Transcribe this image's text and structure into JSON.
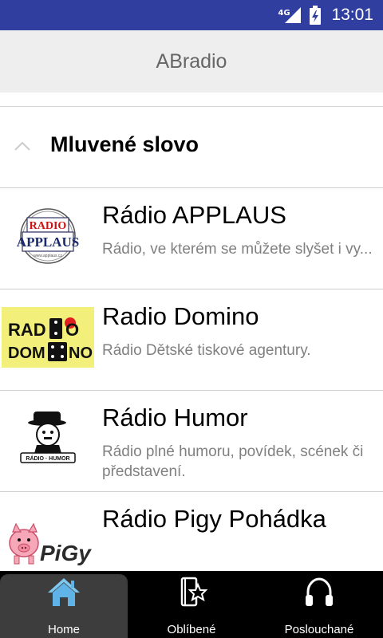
{
  "status_bar": {
    "network_type": "4G",
    "time": "13:01",
    "background_color": "#303f9f",
    "icons": [
      "signal-icon",
      "battery-charging-icon"
    ]
  },
  "app_bar": {
    "title": "ABradio",
    "background_color": "#eeeeee"
  },
  "section": {
    "title": "Mluvené slovo",
    "icon": "chevron-up-icon"
  },
  "stations": [
    {
      "name": "Rádio APPLAUS",
      "description": "Rádio, ve kterém se můžete slyšet i vy...",
      "logo_text": "RADIO APPLAUS"
    },
    {
      "name": "Radio Domino",
      "description": "Rádio Dětské tiskové agentury.",
      "logo_text": "RADIO DOMINO"
    },
    {
      "name": "Rádio Humor",
      "description": "Rádio plné humoru, povídek, scének či představení.",
      "logo_text": "RÁDIO HUMOR"
    },
    {
      "name": "Rádio Pigy Pohádka",
      "description": "",
      "logo_text": "PiGy"
    }
  ],
  "bottom_nav": {
    "background_color": "#000000",
    "active_color": "#3d3d3d",
    "items": [
      {
        "label": "Home",
        "icon": "home-icon",
        "active": true
      },
      {
        "label": "Oblíbené",
        "icon": "favorites-icon",
        "active": false
      },
      {
        "label": "Poslouchané",
        "icon": "headphones-icon",
        "active": false
      }
    ]
  }
}
